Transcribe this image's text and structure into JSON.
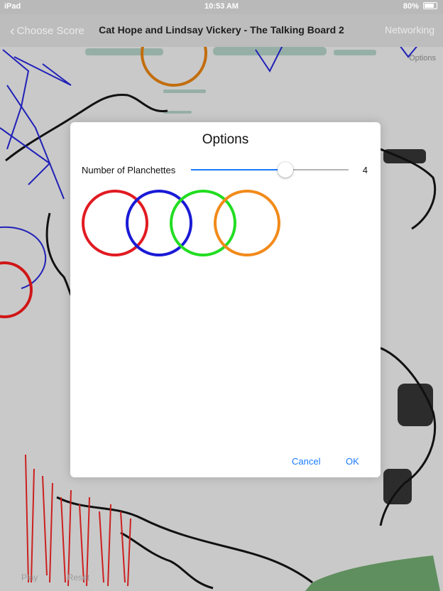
{
  "status_bar": {
    "device": "iPad",
    "time": "10:53 AM",
    "battery": "80%",
    "battery_level": 0.8
  },
  "nav": {
    "back_label": "Choose Score",
    "title": "Cat Hope and Lindsay Vickery - The Talking Board 2",
    "right_label": "Networking",
    "options_label": "Options"
  },
  "bottom_bar": {
    "play_label": "Play",
    "reset_label": "Reset"
  },
  "dialog": {
    "title": "Options",
    "slider_label": "Number of Planchettes",
    "slider_value": "4",
    "slider_fraction": 0.6,
    "cancel_label": "Cancel",
    "ok_label": "OK",
    "planchette_colors": [
      "#e11b22",
      "#1a1ad6",
      "#22dd22",
      "#f28a1a"
    ]
  }
}
